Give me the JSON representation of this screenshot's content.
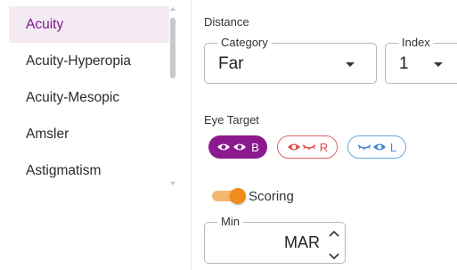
{
  "tests": [
    {
      "label": "Acuity",
      "active": true
    },
    {
      "label": "Acuity-Hyperopia",
      "active": false
    },
    {
      "label": "Acuity-Mesopic",
      "active": false
    },
    {
      "label": "Amsler",
      "active": false
    },
    {
      "label": "Astigmatism",
      "active": false
    }
  ],
  "distance": {
    "label": "Distance",
    "category": {
      "legend": "Category",
      "value": "Far"
    },
    "index": {
      "legend": "Index",
      "value": "1"
    }
  },
  "eye_target": {
    "label": "Eye Target",
    "options": [
      {
        "label": "B",
        "selected": true
      },
      {
        "label": "R",
        "selected": false
      },
      {
        "label": "L",
        "selected": false
      }
    ]
  },
  "scoring": {
    "label": "Scoring",
    "enabled": true
  },
  "min": {
    "legend": "Min",
    "value": "MAR"
  },
  "colors": {
    "accent": "#8b1a8f",
    "right_eye": "#e04848",
    "left_eye": "#3c86cf",
    "toggle": "#f08c1a"
  },
  "icons": [
    "eye-icon",
    "closed-eye-icon",
    "chevron-up-icon",
    "chevron-down-icon",
    "caret-down-icon"
  ]
}
